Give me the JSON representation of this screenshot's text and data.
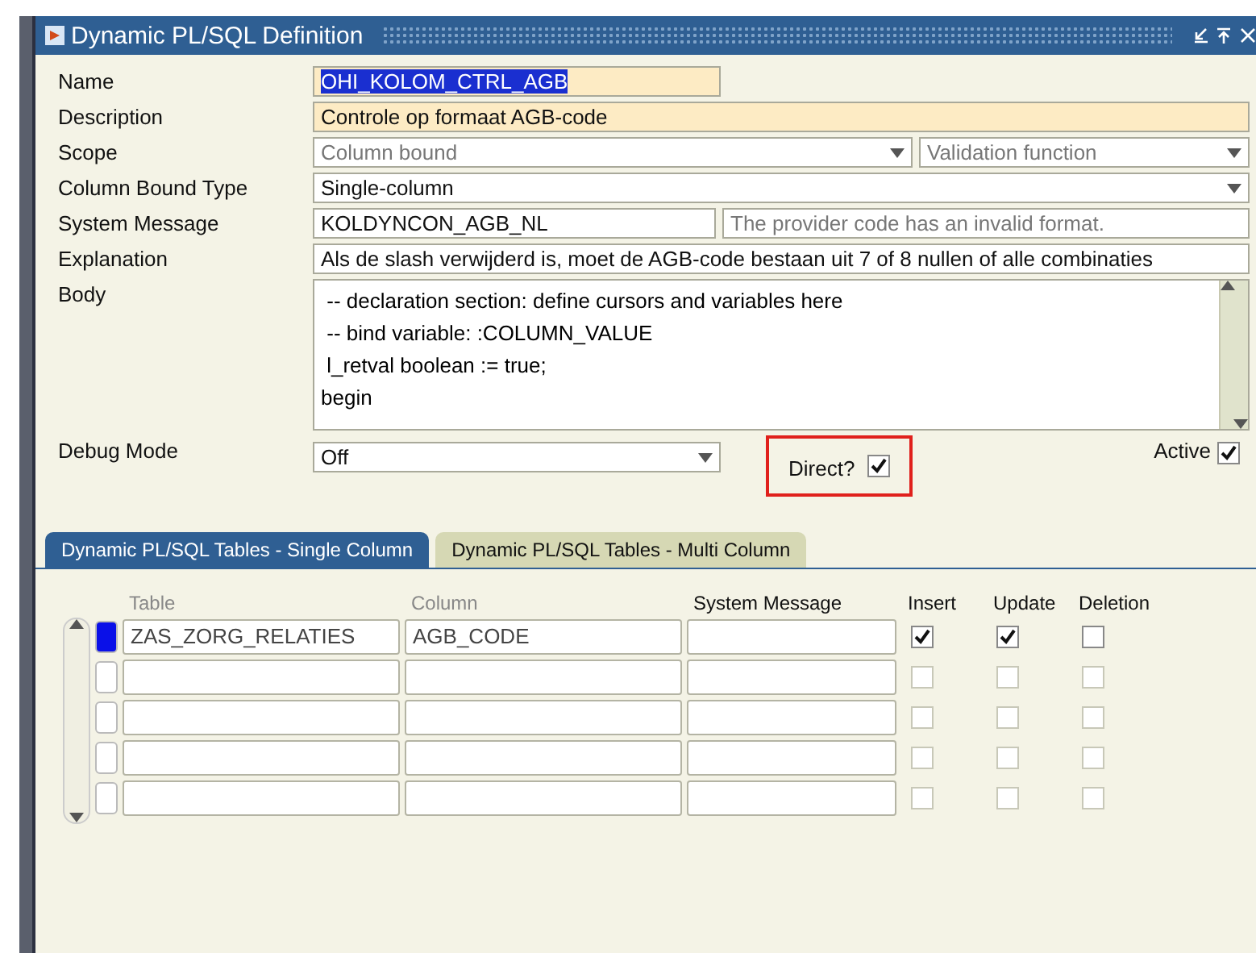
{
  "window": {
    "title": "Dynamic PL/SQL Definition"
  },
  "form": {
    "name": {
      "label": "Name",
      "value": "OHI_KOLOM_CTRL_AGB",
      "selected": true
    },
    "description": {
      "label": "Description",
      "value": "Controle op formaat AGB-code"
    },
    "scope": {
      "label": "Scope",
      "value": "Column bound",
      "value_2": "Validation function",
      "disabled": true
    },
    "column_bound_type": {
      "label": "Column Bound Type",
      "value": "Single-column"
    },
    "system_message": {
      "label": "System Message",
      "value": "KOLDYNCON_AGB_NL",
      "text": "The provider code has an invalid format."
    },
    "explanation": {
      "label": "Explanation",
      "value": "Als de slash verwijderd is, moet de AGB-code bestaan uit 7 of 8 nullen of alle combinaties"
    },
    "body": {
      "label": "Body",
      "lines": [
        " -- declaration section: define cursors and variables here",
        " -- bind variable: :COLUMN_VALUE",
        " l_retval boolean := true;",
        "begin"
      ]
    },
    "debug_mode": {
      "label": "Debug Mode",
      "value": "Off"
    },
    "direct": {
      "label": "Direct?",
      "checked": true,
      "highlighted": true
    },
    "active": {
      "label": "Active",
      "checked": true
    }
  },
  "tabs": [
    {
      "label": "Dynamic PL/SQL Tables - Single Column",
      "selected": true
    },
    {
      "label": "Dynamic PL/SQL Tables - Multi Column",
      "selected": false
    }
  ],
  "table": {
    "columns": [
      {
        "label": "Table",
        "disabled": true
      },
      {
        "label": "Column",
        "disabled": true
      },
      {
        "label": "System Message",
        "disabled": false
      },
      {
        "label": "Insert",
        "disabled": false
      },
      {
        "label": "Update",
        "disabled": false
      },
      {
        "label": "Deletion",
        "disabled": false
      }
    ],
    "rows": [
      {
        "current": true,
        "table": "ZAS_ZORG_RELATIES",
        "column": "AGB_CODE",
        "insert": true,
        "update": true,
        "deletion": false,
        "disabled": false
      },
      {
        "current": false,
        "insert": false,
        "update": false,
        "deletion": false,
        "disabled": true
      },
      {
        "current": false,
        "insert": false,
        "update": false,
        "deletion": false,
        "disabled": true
      },
      {
        "current": false,
        "insert": false,
        "update": false,
        "deletion": false,
        "disabled": true
      },
      {
        "current": false,
        "insert": false,
        "update": false,
        "deletion": false,
        "disabled": true
      }
    ]
  }
}
